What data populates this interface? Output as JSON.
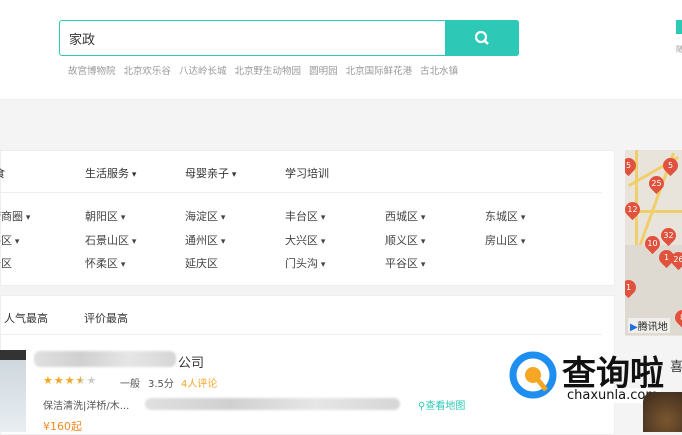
{
  "search": {
    "value": "家政",
    "button_icon": "search-icon",
    "hot_keywords": [
      "故宫博物院",
      "北京欢乐谷",
      "八达岭长城",
      "北京野生动物园",
      "圆明园",
      "北京国际鲜花港",
      "古北水镇"
    ]
  },
  "header_right": {
    "partial_label": "随"
  },
  "categories": [
    "食",
    "生活服务",
    "母婴亲子",
    "学习培训"
  ],
  "category_dropdown": [
    false,
    true,
    true,
    false
  ],
  "areas": [
    [
      "梦商圈",
      "朝阳区",
      "海淀区",
      "丰台区",
      "西城区",
      "东城区"
    ],
    [
      "平区",
      "石景山区",
      "通州区",
      "大兴区",
      "顺义区",
      "房山区"
    ],
    [
      "云区",
      "怀柔区",
      "延庆区",
      "门头沟",
      "平谷区"
    ]
  ],
  "area_dropdown": [
    [
      true,
      true,
      true,
      true,
      true,
      true
    ],
    [
      true,
      true,
      true,
      true,
      true,
      true
    ],
    [
      false,
      true,
      false,
      true,
      true
    ]
  ],
  "sort": [
    "人气最高",
    "评价最高"
  ],
  "listing": {
    "name_suffix": "公司",
    "rating": 3.5,
    "rating_label": "一般",
    "score": "3.5分",
    "reviews": "4人评论",
    "tags": "保洁清洗|洋桥/木...",
    "map_link": "查看地图",
    "price": "¥160起"
  },
  "map": {
    "brand": "腾讯地",
    "pins": [
      "5",
      "25",
      "12",
      "10",
      "32",
      "1",
      "26",
      "5",
      "1",
      "8"
    ]
  },
  "watermark": {
    "title": "查询啦",
    "url": "chaxunla.com",
    "side_text": "喜"
  },
  "colors": {
    "accent": "#2ec9b6",
    "star": "#f5a623",
    "price": "#f08a24",
    "pin": "#e0523d"
  }
}
